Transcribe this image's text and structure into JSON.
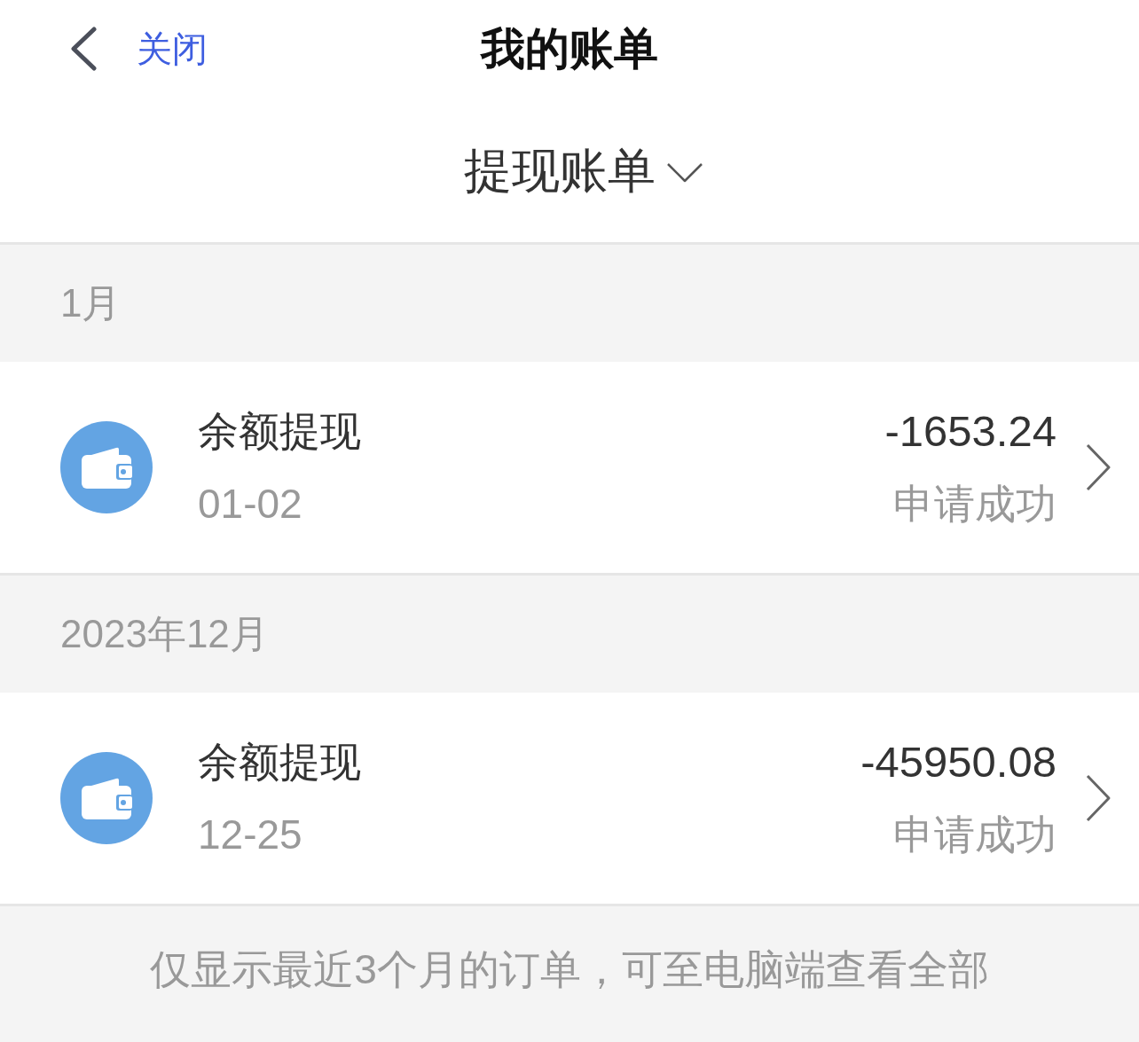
{
  "nav": {
    "close": "关闭",
    "title": "我的账单"
  },
  "filter": {
    "label": "提现账单"
  },
  "groups": [
    {
      "month": "1月",
      "records": [
        {
          "title": "余额提现",
          "date": "01-02",
          "amount": "-1653.24",
          "status": "申请成功"
        }
      ]
    },
    {
      "month": "2023年12月",
      "records": [
        {
          "title": "余额提现",
          "date": "12-25",
          "amount": "-45950.08",
          "status": "申请成功"
        }
      ]
    }
  ],
  "footer": {
    "note": "仅显示最近3个月的订单，可至电脑端查看全部"
  }
}
